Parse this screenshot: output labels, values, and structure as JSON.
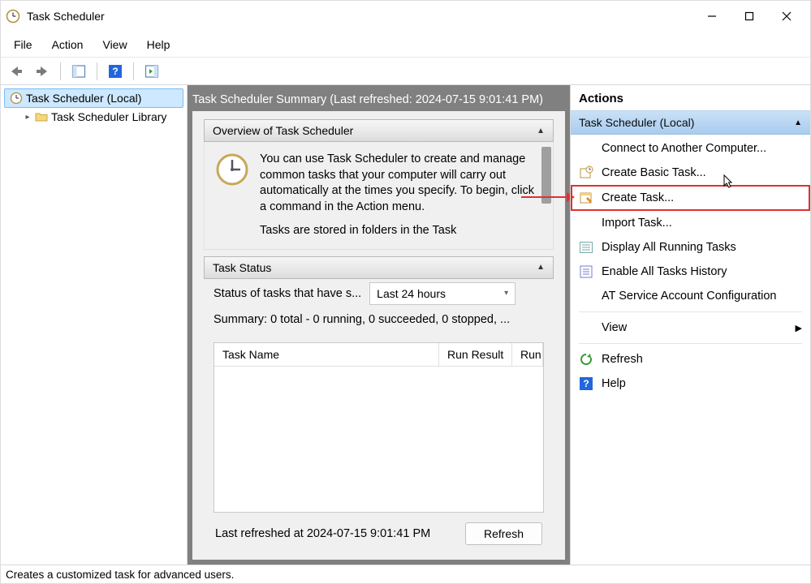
{
  "window_title": "Task Scheduler",
  "menubar": [
    "File",
    "Action",
    "View",
    "Help"
  ],
  "tree": {
    "root_label": "Task Scheduler (Local)",
    "child_label": "Task Scheduler Library"
  },
  "center": {
    "summary_header": "Task Scheduler Summary (Last refreshed: 2024-07-15 9:01:41 PM)",
    "overview_title": "Overview of Task Scheduler",
    "overview_para1": "You can use Task Scheduler to create and manage common tasks that your computer will carry out automatically at the times you specify. To begin, click a command in the Action menu.",
    "overview_para2": "Tasks are stored in folders in the Task",
    "status_title": "Task Status",
    "status_label": "Status of tasks that have s...",
    "status_period": "Last 24 hours",
    "status_summary": "Summary: 0 total - 0 running, 0 succeeded, 0 stopped, ...",
    "table_headers": [
      "Task Name",
      "Run Result",
      "Run"
    ],
    "last_refreshed": "Last refreshed at 2024-07-15 9:01:41 PM",
    "refresh_btn": "Refresh"
  },
  "actions": {
    "title": "Actions",
    "scope": "Task Scheduler (Local)",
    "items": [
      {
        "label": "Connect to Another Computer...",
        "icon": "none"
      },
      {
        "label": "Create Basic Task...",
        "icon": "basic-task"
      },
      {
        "label": "Create Task...",
        "icon": "create-task",
        "highlight": true
      },
      {
        "label": "Import Task...",
        "icon": "none"
      },
      {
        "label": "Display All Running Tasks",
        "icon": "running-tasks"
      },
      {
        "label": "Enable All Tasks History",
        "icon": "history"
      },
      {
        "label": "AT Service Account Configuration",
        "icon": "none"
      },
      {
        "label": "View",
        "icon": "none",
        "submenu": true
      },
      {
        "label": "Refresh",
        "icon": "refresh"
      },
      {
        "label": "Help",
        "icon": "help"
      }
    ]
  },
  "statusbar": "Creates a customized task for advanced users."
}
